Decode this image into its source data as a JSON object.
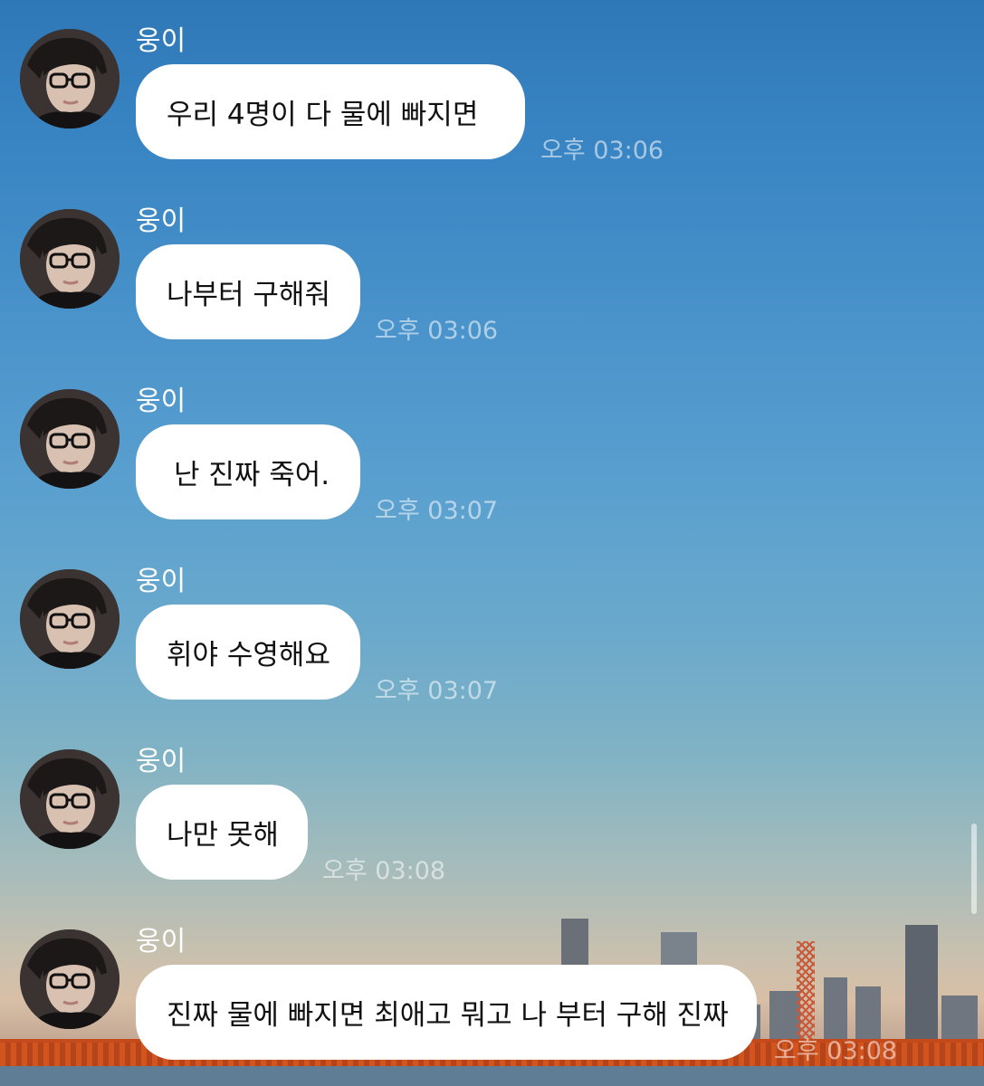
{
  "chat": {
    "messages": [
      {
        "sender": "웅이",
        "text": "우리 4명이 다 물에 빠지면",
        "time": "오후 03:06"
      },
      {
        "sender": "웅이",
        "text": "나부터 구해줘",
        "time": "오후 03:06"
      },
      {
        "sender": "웅이",
        "text": "난 진짜 죽어.",
        "time": "오후 03:07"
      },
      {
        "sender": "웅이",
        "text": "휘야 수영해요",
        "time": "오후 03:07"
      },
      {
        "sender": "웅이",
        "text": "나만 못해",
        "time": "오후 03:08"
      },
      {
        "sender": "웅이",
        "text": "진짜 물에 빠지면 최애고 뭐고 나 부터 구해 진짜",
        "time": "오후 03:08"
      }
    ]
  },
  "colors": {
    "bubble": "#ffffff",
    "sender_text": "#ffffff",
    "time_text": "rgba(255,255,255,0.55)"
  },
  "icons": {
    "avatar": "profile-photo"
  }
}
